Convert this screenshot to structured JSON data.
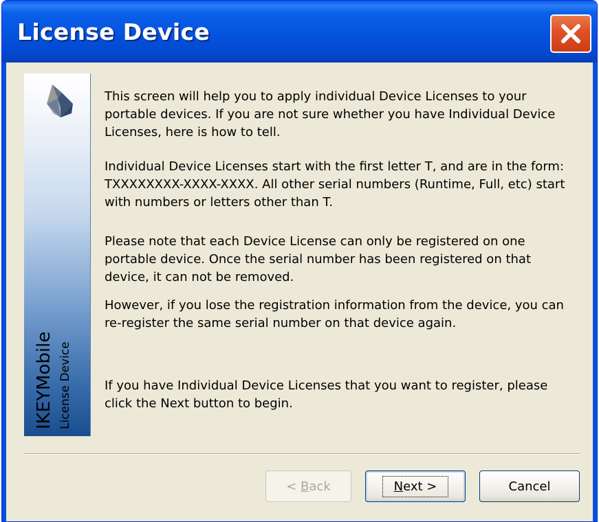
{
  "window": {
    "title": "License Device",
    "close_icon": "close-icon",
    "titlebar_color": "#0453dd",
    "close_color": "#e0532a"
  },
  "side_panel": {
    "logo_icon": "ikey-logo-icon",
    "brand": "IKEYMobile",
    "subtitle": "License Device"
  },
  "content": {
    "paragraph1": "This screen will help you to apply individual Device Licenses to your portable devices.  If you are not sure whether you have Individual Device Licenses, here is how to tell.",
    "paragraph2": "Individual Device Licenses start with the first letter T, and are in the form:  TXXXXXXXX-XXXX-XXXX.  All other serial numbers (Runtime, Full, etc) start with numbers or letters other than T.",
    "paragraph3": "Please note that each Device License can only be registered on one portable device.  Once the serial number has been registered on that device, it can not be removed.",
    "paragraph4": "However, if you lose the registration information from the device, you can re-register the same serial number on that device again.",
    "paragraph5": "If you have Individual Device Licenses that you want to register, please click the Next button to begin."
  },
  "buttons": {
    "back_prefix": "< ",
    "back_mnemonic": "B",
    "back_rest": "ack",
    "next_mnemonic": "N",
    "next_rest": "ext >",
    "cancel": "Cancel"
  }
}
